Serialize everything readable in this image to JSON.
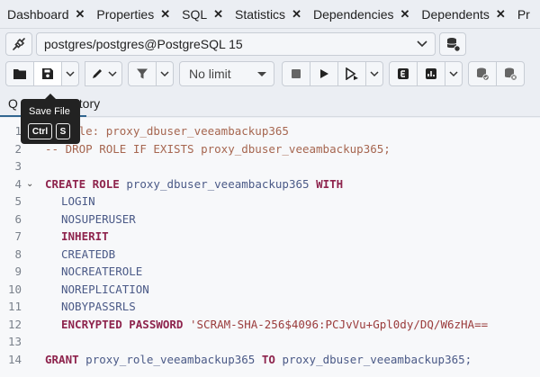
{
  "tabs": [
    {
      "label": "Dashboard"
    },
    {
      "label": "Properties"
    },
    {
      "label": "SQL"
    },
    {
      "label": "Statistics"
    },
    {
      "label": "Dependencies"
    },
    {
      "label": "Dependents"
    },
    {
      "label": "Pr"
    }
  ],
  "tab_close_glyph": "✕",
  "connection": {
    "value": "postgres/postgres@PostgreSQL 15"
  },
  "toolbar": {
    "limit_value": "No limit"
  },
  "tooltip": {
    "title": "Save File",
    "key1": "Ctrl",
    "key2": "S"
  },
  "query_tabs": {
    "first_visible": "Q",
    "second_visible": "ry History"
  },
  "editor": {
    "line_numbers": [
      "1",
      "2",
      "3",
      "4",
      "5",
      "6",
      "7",
      "8",
      "9",
      "10",
      "11",
      "12",
      "13",
      "14"
    ],
    "lines": {
      "l1_comment": "Role: proxy_dbuser_veeambackup365",
      "l1_prefix": "-- ",
      "l2_comment": "-- DROP ROLE IF EXISTS proxy_dbuser_veeambackup365;",
      "l4_create": "CREATE ROLE",
      "l4_name": "proxy_dbuser_veeambackup365",
      "l4_with": "WITH",
      "l5": "LOGIN",
      "l6": "NOSUPERUSER",
      "l7": "INHERIT",
      "l8": "CREATEDB",
      "l9": "NOCREATEROLE",
      "l10": "NOREPLICATION",
      "l11": "NOBYPASSRLS",
      "l12_kw": "ENCRYPTED PASSWORD",
      "l12_str": "'SCRAM-SHA-256$4096:PCJvVu+Gpl0dy/DQ/W6zHA==",
      "l14_grant": "GRANT",
      "l14_role": "proxy_role_veeambackup365",
      "l14_to": "TO",
      "l14_user": "proxy_dbuser_veeambackup365;"
    }
  },
  "colors": {
    "keyword": "#8e244d",
    "identifier": "#4b5a87",
    "comment": "#a66650",
    "accent": "#326690"
  }
}
